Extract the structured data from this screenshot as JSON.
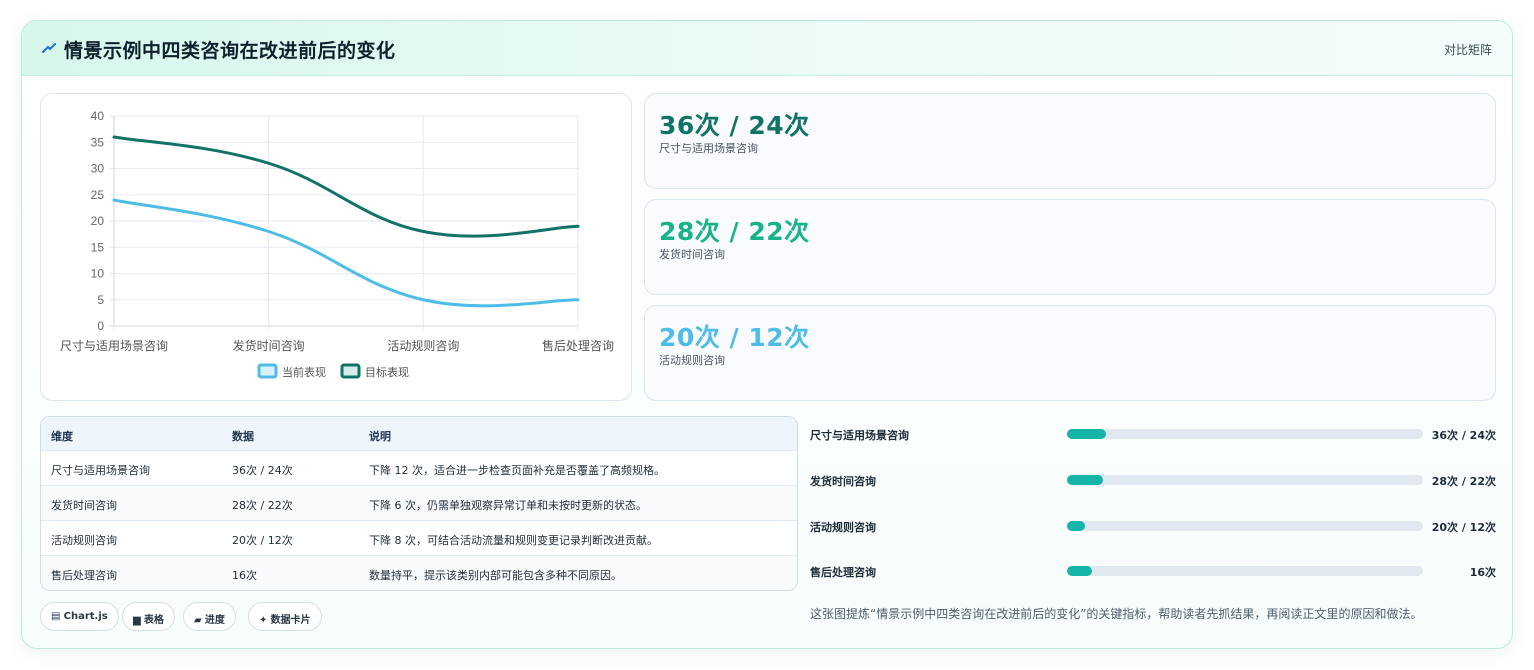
{
  "header": {
    "title": "情景示例中四类咨询在改进前后的变化",
    "tag": "对比矩阵"
  },
  "colors": {
    "current": "#4dbde8",
    "target": "#117366",
    "accent_green": "#17b38a",
    "progress_fill": "#14b5a8"
  },
  "chart_data": {
    "type": "line",
    "categories": [
      "尺寸与适用场景咨询",
      "发货时间咨询",
      "活动规则咨询",
      "售后处理咨询"
    ],
    "series": [
      {
        "name": "当前表现",
        "values": [
          24,
          18,
          5,
          5
        ]
      },
      {
        "name": "目标表现",
        "values": [
          36,
          31,
          18,
          19
        ]
      }
    ],
    "ylim": [
      0,
      40
    ],
    "yticks": [
      "0",
      "5",
      "10",
      "15",
      "20",
      "25",
      "30",
      "35",
      "40"
    ],
    "grid": true,
    "legend": "bottom"
  },
  "metrics": [
    {
      "value": "36次 / 24次",
      "label": "尺寸与适用场景咨询",
      "color": "#117366"
    },
    {
      "value": "28次 / 22次",
      "label": "发货时间咨询",
      "color": "#17b38a"
    },
    {
      "value": "20次 / 12次",
      "label": "活动规则咨询",
      "color": "#4dbde8"
    }
  ],
  "table": {
    "headers": [
      "维度",
      "数据",
      "说明"
    ],
    "rows": [
      [
        "尺寸与适用场景咨询",
        "36次 / 24次",
        "下降 12 次，适合进一步检查页面补充是否覆盖了高频规格。"
      ],
      [
        "发货时间咨询",
        "28次 / 22次",
        "下降 6 次，仍需单独观察异常订单和未按时更新的状态。"
      ],
      [
        "活动规则咨询",
        "20次 / 12次",
        "下降 8 次，可结合活动流量和规则变更记录判断改进贡献。"
      ],
      [
        "售后处理咨询",
        "16次",
        "数量持平，提示该类别内部可能包含多种不同原因。"
      ]
    ]
  },
  "progress": [
    {
      "label": "尺寸与适用场景咨询",
      "value": "36次 / 24次",
      "fraction": 0.11
    },
    {
      "label": "发货时间咨询",
      "value": "28次 / 22次",
      "fraction": 0.1
    },
    {
      "label": "活动规则咨询",
      "value": "20次 / 12次",
      "fraction": 0.05
    },
    {
      "label": "售后处理咨询",
      "value": "16次",
      "fraction": 0.07
    }
  ],
  "note": "这张图提炼“情景示例中四类咨询在改进前后的变化”的关键指标，帮助读者先抓结果，再阅读正文里的原因和做法。",
  "chips": [
    {
      "icon": "▤",
      "label": "Chart.js"
    },
    {
      "icon": "▆",
      "label": "表格"
    },
    {
      "icon": "▰",
      "label": "进度"
    },
    {
      "icon": "✦",
      "label": "数据卡片"
    }
  ]
}
